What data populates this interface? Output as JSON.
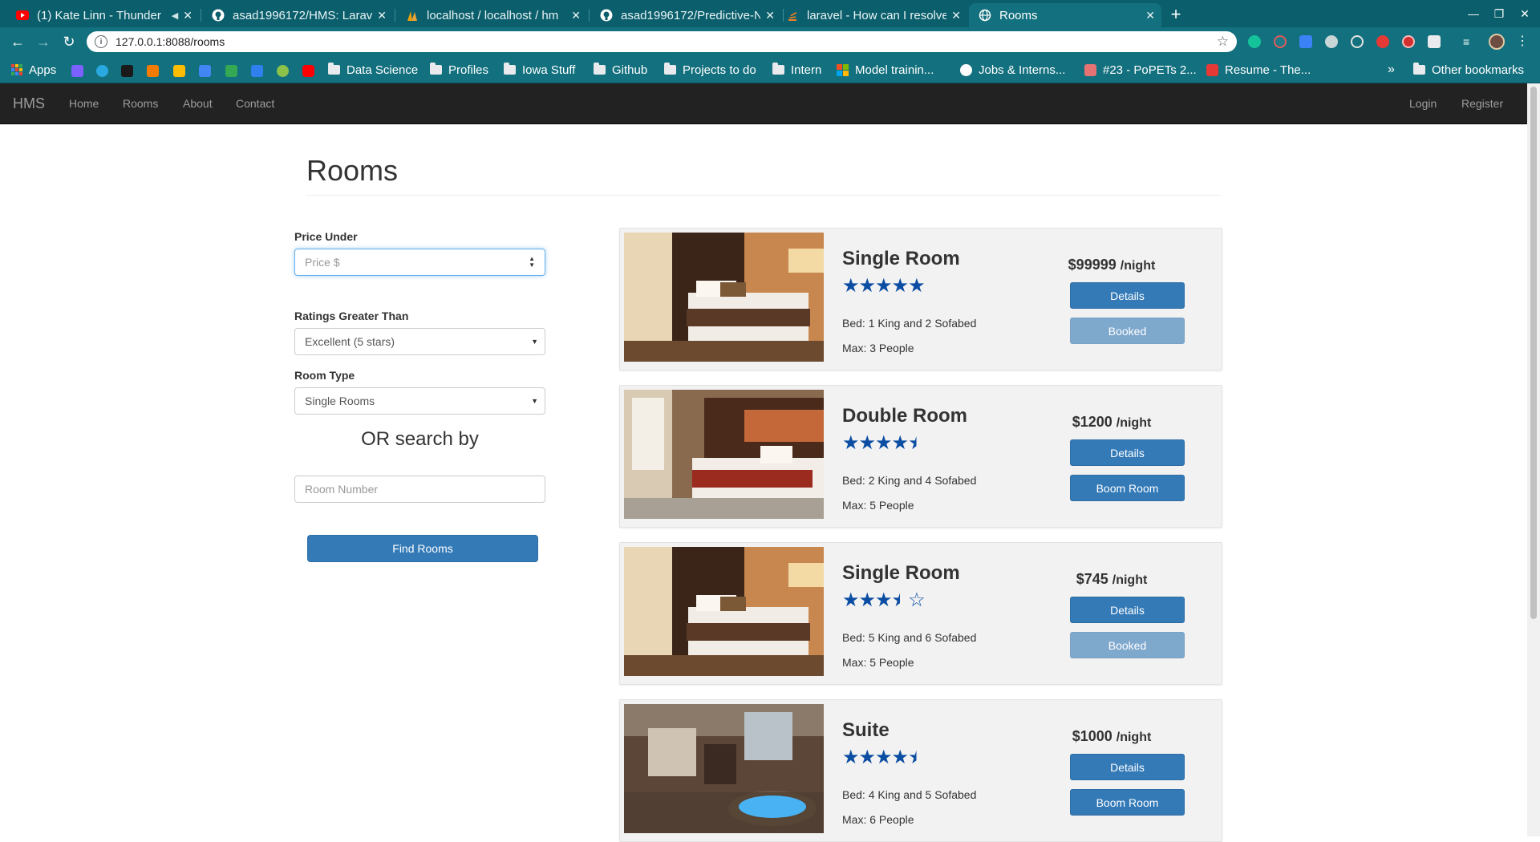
{
  "browser": {
    "tabs": [
      {
        "title": "(1) Kate Linn - Thunder",
        "icon": "youtube-icon"
      },
      {
        "title": "asad1996172/HMS: Larav",
        "icon": "github-icon"
      },
      {
        "title": "localhost / localhost / hm",
        "icon": "phpmyadmin-icon"
      },
      {
        "title": "asad1996172/Predictive-N",
        "icon": "github-icon"
      },
      {
        "title": "laravel - How can I resolve",
        "icon": "stackoverflow-icon"
      },
      {
        "title": "Rooms",
        "icon": "globe-icon",
        "active": true
      }
    ],
    "address": "127.0.0.1:8088/rooms",
    "bookmarks": [
      {
        "label": "Apps",
        "icon": "apps-icon"
      },
      {
        "label": "Data Science",
        "icon": "folder-icon"
      },
      {
        "label": "Profiles",
        "icon": "folder-icon"
      },
      {
        "label": "Iowa Stuff",
        "icon": "folder-icon"
      },
      {
        "label": "Github",
        "icon": "folder-icon"
      },
      {
        "label": "Projects to do",
        "icon": "folder-icon"
      },
      {
        "label": "Intern",
        "icon": "folder-icon"
      },
      {
        "label": "Model trainin...",
        "icon": "microsoft-icon"
      },
      {
        "label": "Jobs & Interns...",
        "icon": "site-icon"
      },
      {
        "label": "#23 - PoPETs 2...",
        "icon": "site-icon"
      },
      {
        "label": "Resume - The...",
        "icon": "site-icon"
      }
    ],
    "more_bookmarks": "»",
    "other_bookmarks": "Other bookmarks"
  },
  "site_nav": {
    "brand": "HMS",
    "links": [
      "Home",
      "Rooms",
      "About",
      "Contact"
    ],
    "login": "Login",
    "register": "Register"
  },
  "page": {
    "title": "Rooms"
  },
  "filters": {
    "price_label": "Price Under",
    "price_placeholder": "Price $",
    "ratings_label": "Ratings Greater Than",
    "ratings_value": "Excellent (5 stars)",
    "room_type_label": "Room Type",
    "room_type_value": "Single Rooms",
    "or_search": "OR search by",
    "room_number_placeholder": "Room Number",
    "find_button": "Find Rooms"
  },
  "rooms": [
    {
      "name": "Single Room",
      "rating": 5,
      "price": "$99999",
      "unit": "/night",
      "bed": "Bed: 1 King and 2 Sofabed",
      "max": "Max: 3 People",
      "details": "Details",
      "action": "Booked",
      "action_disabled": true,
      "image": "hotel-room-photo"
    },
    {
      "name": "Double Room",
      "rating": 4.5,
      "price": "$1200",
      "unit": "/night",
      "bed": "Bed: 2 King and 4 Sofabed",
      "max": "Max: 5 People",
      "details": "Details",
      "action": "Boom Room",
      "action_disabled": false,
      "image": "hotel-room-photo"
    },
    {
      "name": "Single Room",
      "rating": 3.5,
      "price": "$745",
      "unit": "/night",
      "bed": "Bed: 5 King and 6 Sofabed",
      "max": "Max: 5 People",
      "details": "Details",
      "action": "Booked",
      "action_disabled": true,
      "image": "hotel-room-photo"
    },
    {
      "name": "Suite",
      "rating": 4.5,
      "price": "$1000",
      "unit": "/night",
      "bed": "Bed: 4 King and 5 Sofabed",
      "max": "Max: 6 People",
      "details": "Details",
      "action": "Boom Room",
      "action_disabled": false,
      "image": "suite-photo"
    }
  ],
  "colors": {
    "primary": "#337ab7",
    "primary_disabled": "#7fa8cd",
    "star": "#0b4da2",
    "navbar": "#222222",
    "browser_frame": "#13707e"
  }
}
